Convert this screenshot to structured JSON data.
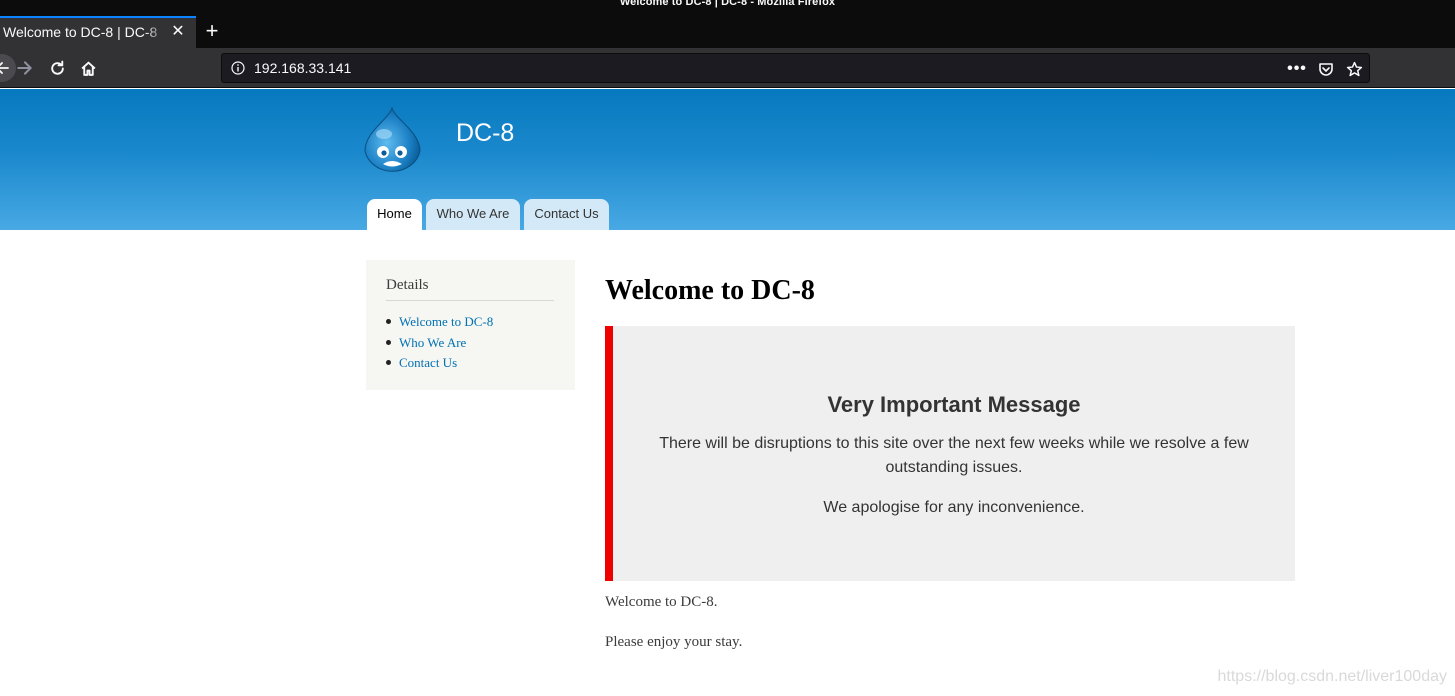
{
  "window": {
    "title": "Welcome to DC-8 | DC-8 - Mozilla Firefox"
  },
  "tab": {
    "title": "Welcome to DC-8 | DC-8",
    "close_glyph": "✕",
    "new_tab_glyph": "+"
  },
  "toolbar": {
    "url": "192.168.33.141",
    "icons": [
      "back-arrow-icon",
      "forward-arrow-icon",
      "reload-icon",
      "home-icon",
      "info-icon",
      "more-dots-icon",
      "pocket-icon",
      "bookmark-star-icon"
    ],
    "more_glyph": "•••"
  },
  "site": {
    "name": "DC-8",
    "menu": [
      "Home",
      "Who We Are",
      "Contact Us"
    ],
    "active_menu": "Home",
    "header_colors": {
      "top": "#0779bf",
      "bottom": "#48a9e4"
    }
  },
  "sidebar": {
    "title": "Details",
    "links": [
      "Welcome to DC-8",
      "Who We Are",
      "Contact Us"
    ]
  },
  "content": {
    "title": "Welcome to DC-8",
    "notice": {
      "heading": "Very Important Message",
      "text": "There will be disruptions to this site over the next few weeks while we resolve a few outstanding issues.",
      "apology": "We apologise for any inconvenience.",
      "accent_color": "#ee0000"
    },
    "paragraphs": [
      "Welcome to DC-8.",
      "Please enjoy your stay."
    ]
  },
  "watermark": "https://blog.csdn.net/liver100day"
}
